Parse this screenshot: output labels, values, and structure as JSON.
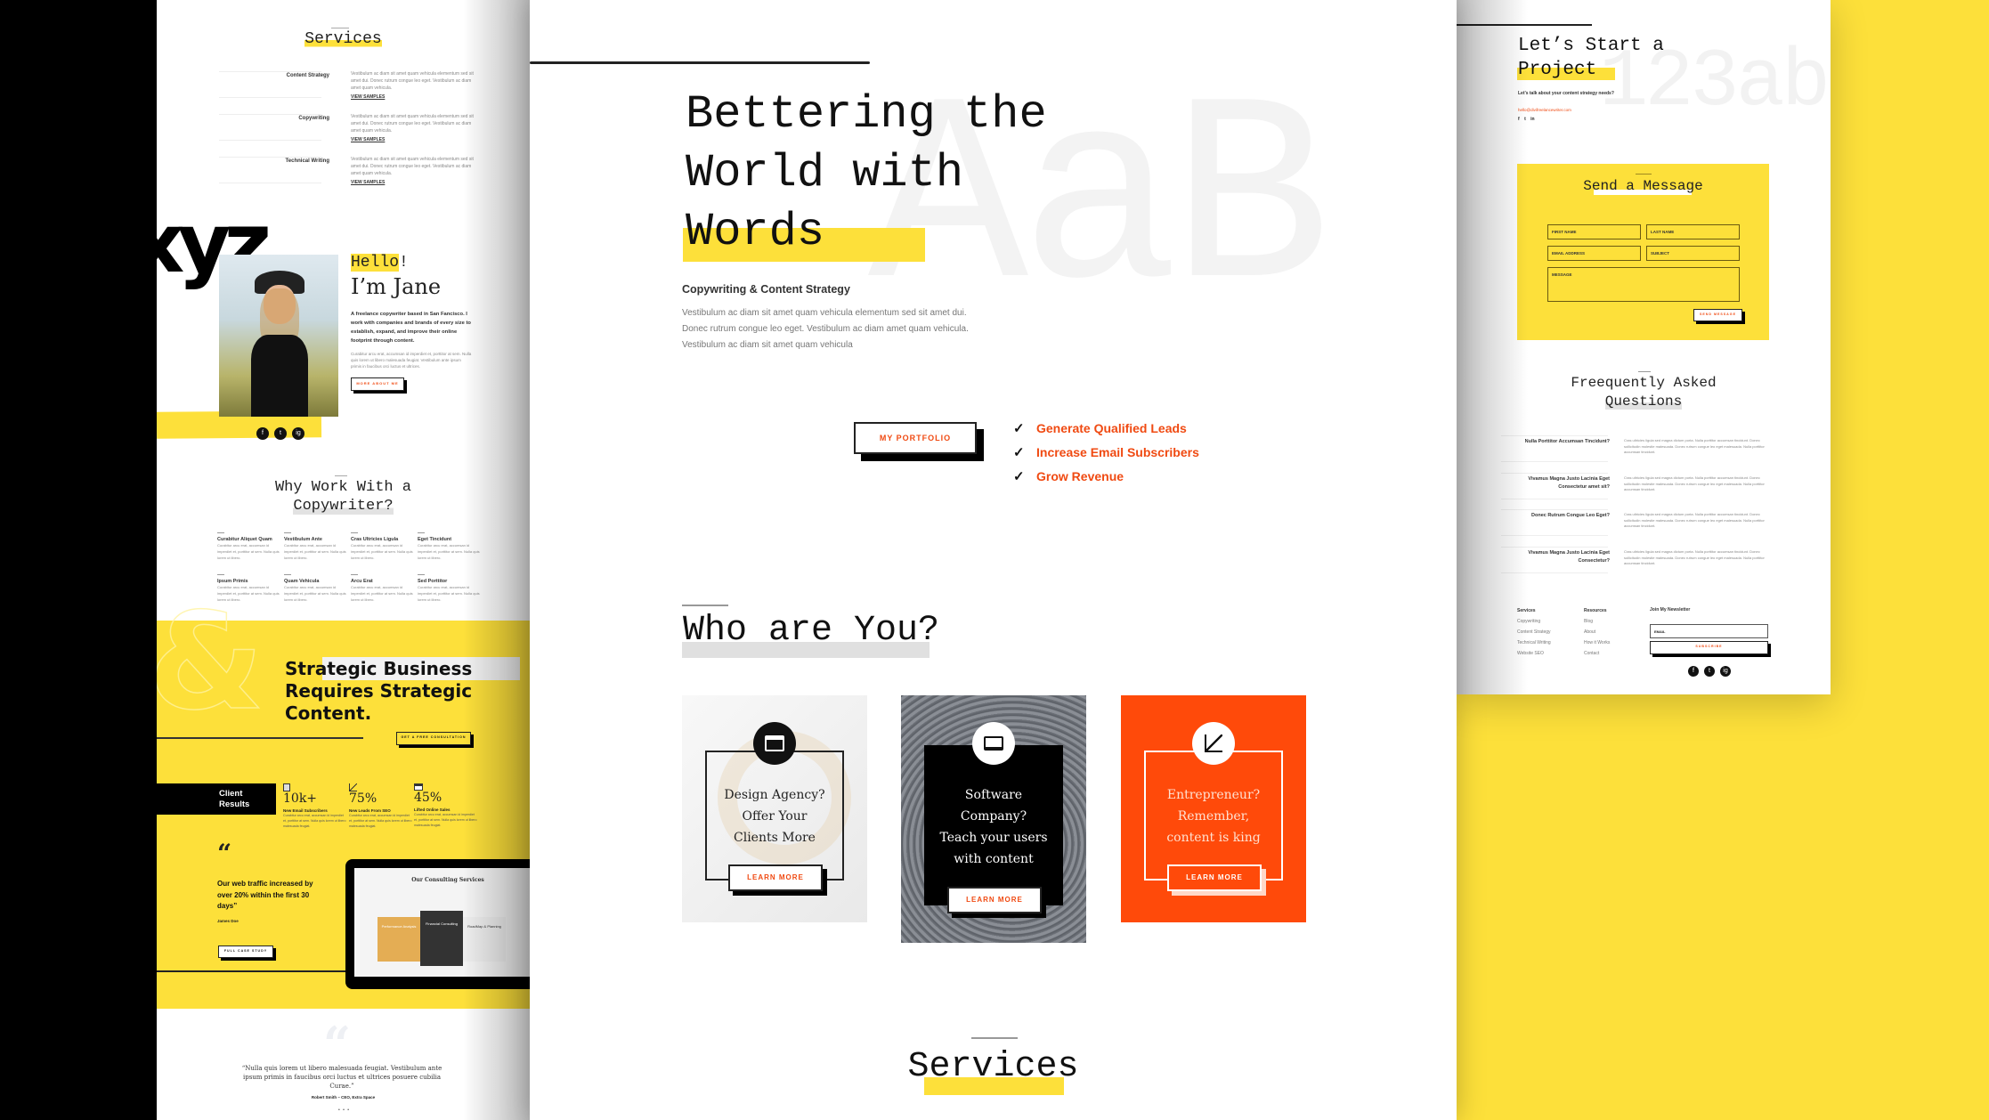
{
  "left": {
    "services": {
      "title": "Services",
      "items": [
        {
          "name": "Content Strategy",
          "desc": "Vestibulum ac diam sit amet quam vehicula elementum sed sit amet dui. Donec rutrum congue leo eget. Vestibulum ac diam amet quam vehicula.",
          "link": "VIEW SAMPLES"
        },
        {
          "name": "Copywriting",
          "desc": "Vestibulum ac diam sit amet quam vehicula elementum sed sit amet dui. Donec rutrum congue leo eget. Vestibulum ac diam amet quam vehicula.",
          "link": "VIEW SAMPLES"
        },
        {
          "name": "Technical Writing",
          "desc": "Vestibulum ac diam sit amet quam vehicula elementum sed sit amet dui. Donec rutrum congue leo eget. Vestibulum ac diam amet quam vehicula.",
          "link": "VIEW SAMPLES"
        }
      ]
    },
    "about": {
      "bg_letters": "xyz",
      "hello": "Hello",
      "hello_bang": "!",
      "name": "I’m Jane",
      "intro": "A freelance copywriter based in San Fancisco. I work with companies and brands of every size to establish, expand, and improve their online footprint through content.",
      "body": "Curabitur arcu erat, accumsan id imperdiet et, porttitor at sem. Nulla quis lorem ut libero malesuada feugiat. Vestibulum ante ipsum primis in faucibus orci luctus et ultrices.",
      "button": "MORE ABOUT ME",
      "social": [
        "f",
        "t",
        "ig"
      ]
    },
    "why": {
      "title_line1": "Why Work With a",
      "title_line2": "Copywriter?",
      "items": [
        {
          "title": "Curabitur Aliquet Quam",
          "desc": "Curabitur arcu erat, accumsan id imperdiet et, porttitor at sem. Nulla quis lorem ut libero."
        },
        {
          "title": "Vestibulum Ante",
          "desc": "Curabitur arcu erat, accumsan id imperdiet et, porttitor at sem. Nulla quis lorem ut libero."
        },
        {
          "title": "Cras Ultricies Ligula",
          "desc": "Curabitur arcu erat, accumsan id imperdiet et, porttitor at sem. Nulla quis lorem ut libero."
        },
        {
          "title": "Eget Tincidunt",
          "desc": "Curabitur arcu erat, accumsan id imperdiet et, porttitor at sem. Nulla quis lorem ut libero."
        },
        {
          "title": "Ipsum Primis",
          "desc": "Curabitur arcu erat, accumsan id imperdiet et, porttitor at sem. Nulla quis lorem ut libero."
        },
        {
          "title": "Quam Vehicula",
          "desc": "Curabitur arcu erat, accumsan id imperdiet et, porttitor at sem. Nulla quis lorem ut libero."
        },
        {
          "title": "Arcu Erat",
          "desc": "Curabitur arcu erat, accumsan id imperdiet et, porttitor at sem. Nulla quis lorem ut libero."
        },
        {
          "title": "Sed Porttitor",
          "desc": "Curabitur arcu erat, accumsan id imperdiet et, porttitor at sem. Nulla quis lorem ut libero."
        }
      ]
    },
    "strategic": {
      "bg_glyph": "&",
      "headline_1": "Strategic Business",
      "headline_2": "Requires Strategic",
      "headline_3": "Content.",
      "button": "GET A FREE CONSULTATION"
    },
    "results": {
      "label_1": "Client",
      "label_2": "Results",
      "stats": [
        {
          "value": "10k+",
          "label": "New Email Subscribers",
          "desc": "Curabitur arcu erat, accumsan id imperdiet et, porttitor at sem. Nulla quis lorem ut libero malesuada feugiat."
        },
        {
          "value": "75%",
          "label": "New Leads From SEO",
          "desc": "Curabitur arcu erat, accumsan id imperdiet et, porttitor at sem. Nulla quis lorem ut libero malesuada feugiat."
        },
        {
          "value": "45%",
          "label": "Lifted Online Sales",
          "desc": "Curabitur arcu erat, accumsan id imperdiet et, porttitor at sem. Nulla quis lorem ut libero malesuada feugiat."
        }
      ]
    },
    "case": {
      "quote_mark": "“",
      "quote": "Our web traffic increased by over 20% within the first 30 days”",
      "author": "James Doe",
      "button": "FULL CASE STUDY",
      "laptop": {
        "title": "Our Consulting Services",
        "cards": [
          "Performance Analysis",
          "Financial Consulting",
          "RoadMap & Planning"
        ]
      }
    },
    "testimonial": {
      "quote": "“Nulla quis lorem ut libero malesuada feugiat. Vestibulum ante ipsum primis in faucibus orci luctus et ultrices posuere cubilia Curae.”",
      "author": "Robert Smith – CEO, Extra Space"
    }
  },
  "center": {
    "hero": {
      "bg_letters": "AaB",
      "title_1": "Bettering the",
      "title_2": "World with",
      "title_3": "Words",
      "subtitle": "Copywriting & Content Strategy",
      "body": "Vestibulum ac diam sit amet quam vehicula elementum sed sit amet dui. Donec rutrum congue leo eget. Vestibulum ac diam amet quam vehicula. Vestibulum ac diam sit amet quam vehicula",
      "button": "MY PORTFOLIO",
      "checklist": [
        "Generate Qualified Leads",
        "Increase Email Subscribers",
        "Grow Revenue"
      ]
    },
    "who": {
      "title": "Who are You?",
      "cards": [
        {
          "icon": "browser-icon",
          "text_1": "Design Agency?",
          "text_2": "Offer Your",
          "text_3": "Clients More",
          "button": "LEARN MORE"
        },
        {
          "icon": "monitor-icon",
          "text_1": "Software",
          "text_2": "Company?",
          "text_3": "Teach your users",
          "text_4": "with content",
          "button": "LEARN MORE"
        },
        {
          "icon": "chart-icon",
          "text_1": "Entrepreneur?",
          "text_2": "Remember,",
          "text_3": "content is king",
          "button": "LEARN MORE"
        }
      ]
    },
    "services_title": "Services"
  },
  "right": {
    "contact": {
      "bg_letters": "123ab",
      "title_1": "Let’s Start a",
      "title_2": "Project",
      "subtitle": "Let’s talk about your content strategy needs?",
      "email": "hello@divifreelancewriter.com",
      "social": [
        "f",
        "t",
        "in"
      ]
    },
    "form": {
      "title": "Send a Message",
      "first_name": "FIRST NAME",
      "last_name": "LAST NAME",
      "email": "EMAIL ADDRESS",
      "subject": "SUBJECT",
      "message": "MESSAGE",
      "button": "SEND MESSAGE"
    },
    "faq": {
      "title_1": "Freequently Asked",
      "title_2": "Questions",
      "items": [
        {
          "q": "Nulla Porttitor Accumsan Tincidunt?",
          "a": "Cras ultricies ligula sed magna dictum porta. Nulla porttitor accumsan tincidunt. Donec sollicitudin molestie malesuada. Donec rutrum congue leo eget malesuada. Nulla porttitor accumsan tincidunt."
        },
        {
          "q": "Vivamus Magna Justo Lacinia Eget Consectetur amet sit?",
          "a": "Cras ultricies ligula sed magna dictum porta. Nulla porttitor accumsan tincidunt. Donec sollicitudin molestie malesuada. Donec rutrum congue leo eget malesuada. Nulla porttitor accumsan tincidunt."
        },
        {
          "q": "Donec Rutrum Congue Leo Eget?",
          "a": "Cras ultricies ligula sed magna dictum porta. Nulla porttitor accumsan tincidunt. Donec sollicitudin molestie malesuada. Donec rutrum congue leo eget malesuada. Nulla porttitor accumsan tincidunt."
        },
        {
          "q": "Vivamus Magna Justo Lacinia Eget Consectetur?",
          "a": "Cras ultricies ligula sed magna dictum porta. Nulla porttitor accumsan tincidunt. Donec sollicitudin molestie malesuada. Donec rutrum congue leo eget malesuada. Nulla porttitor accumsan tincidunt."
        }
      ]
    },
    "footer": {
      "services_head": "Services",
      "services": [
        "Copywriting",
        "Content Strategy",
        "Technical Writing",
        "Website SEO"
      ],
      "resources_head": "Resources",
      "resources": [
        "Blog",
        "About",
        "How it Works",
        "Contact"
      ],
      "newsletter_head": "Join My Newsletter",
      "email_placeholder": "EMAIL",
      "subscribe": "SUBSCRIBE",
      "social": [
        "f",
        "t",
        "ig"
      ]
    }
  },
  "colors": {
    "yellow": "#fde03a",
    "orange": "#f04a12",
    "black": "#000000"
  }
}
